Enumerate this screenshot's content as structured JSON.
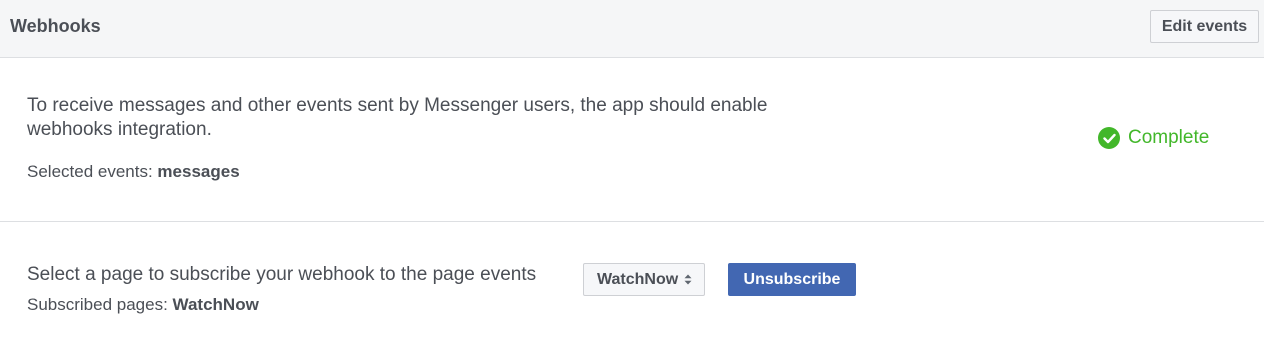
{
  "header": {
    "title": "Webhooks",
    "edit_button": "Edit events"
  },
  "webhook": {
    "description": "To receive messages and other events sent by Messenger users, the app should enable webhooks integration.",
    "selected_label": "Selected events: ",
    "selected_value": "messages",
    "status": "Complete",
    "status_icon": "check-circle-icon",
    "status_color": "#42b72a"
  },
  "subscription": {
    "instruction": "Select a page to subscribe your webhook to the page events",
    "page_selected": "WatchNow",
    "unsubscribe_button": "Unsubscribe",
    "subscribed_label": "Subscribed pages: ",
    "subscribed_value": "WatchNow",
    "button_color": "#4267b2"
  }
}
